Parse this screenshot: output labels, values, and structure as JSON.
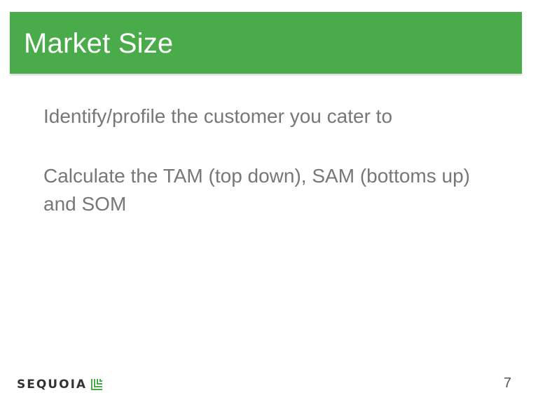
{
  "slide": {
    "title": "Market Size",
    "bullets": [
      "Identify/profile the customer you cater to",
      "Calculate the TAM (top down), SAM (bottoms up) and SOM"
    ],
    "footer": {
      "logo_text": "SEQUOIA",
      "logo_icon": "sequoia-logo-icon",
      "page_number": "7"
    },
    "colors": {
      "title_bar": "#4aab4a",
      "body_text": "#777777",
      "logo_green": "#4aab4a"
    }
  }
}
